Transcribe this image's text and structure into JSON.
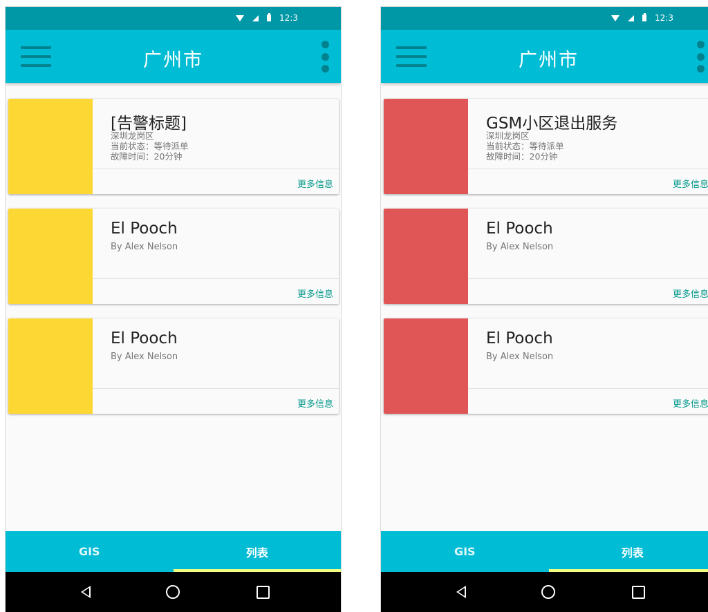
{
  "screens": [
    {
      "status": {
        "time": "12:3"
      },
      "app_bar": {
        "title": "广州市"
      },
      "cards": [
        {
          "title": "[告警标题]",
          "lines": [
            "深圳龙岗区",
            "当前状态：等待派单",
            "故障时间：20分钟"
          ],
          "action": "更多信息",
          "accent_color": "#fdd835"
        },
        {
          "title": "El Pooch",
          "subtitle": "By Alex Nelson",
          "action": "更多信息",
          "accent_color": "#fdd835"
        },
        {
          "title": "El Pooch",
          "subtitle": "By Alex Nelson",
          "action": "更多信息",
          "accent_color": "#fdd835"
        }
      ],
      "tabs": [
        {
          "label": "GIS"
        },
        {
          "label": "列表"
        }
      ]
    },
    {
      "status": {
        "time": "12:3"
      },
      "app_bar": {
        "title": "广州市"
      },
      "cards": [
        {
          "title": "GSM小区退出服务",
          "lines": [
            "深圳龙岗区",
            "当前状态：等待派单",
            "故障时间：20分钟"
          ],
          "action": "更多信息",
          "accent_color": "#e05555"
        },
        {
          "title": "El Pooch",
          "subtitle": "By Alex Nelson",
          "action": "更多信息",
          "accent_color": "#e05555"
        },
        {
          "title": "El Pooch",
          "subtitle": "By Alex Nelson",
          "action": "更多信息",
          "accent_color": "#e05555"
        }
      ],
      "tabs": [
        {
          "label": "GIS"
        },
        {
          "label": "列表"
        }
      ]
    }
  ],
  "theme": {
    "primary": "#00bcd4",
    "primary_dark": "#0097a7",
    "icon_color": "#00838f",
    "action_color": "#009688",
    "tab_indicator": "#f4ff81"
  }
}
